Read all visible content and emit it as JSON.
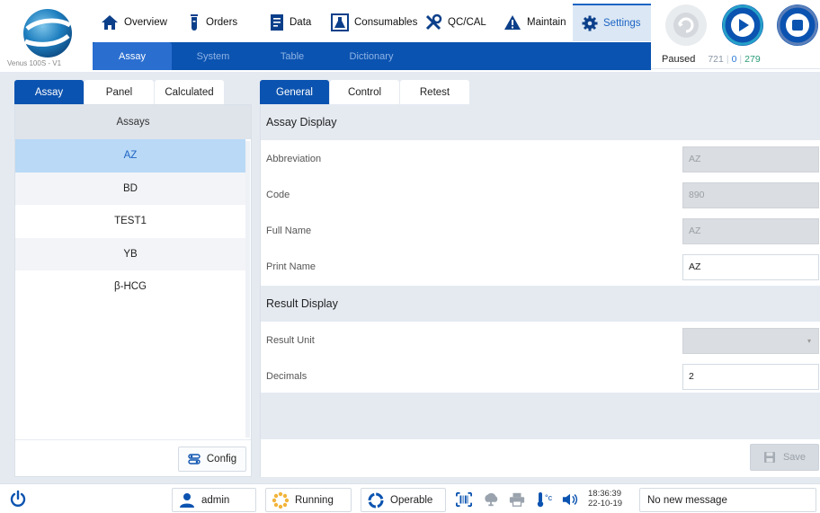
{
  "app": {
    "version": "Venus 100S - V1"
  },
  "nav": {
    "items": [
      {
        "label": "Overview",
        "icon": "home-icon"
      },
      {
        "label": "Orders",
        "icon": "test-tube-icon"
      },
      {
        "label": "Data",
        "icon": "document-icon"
      },
      {
        "label": "Consumables",
        "icon": "flask-icon"
      },
      {
        "label": "QC/CAL",
        "icon": "tools-icon"
      },
      {
        "label": "Maintain",
        "icon": "warning-icon"
      },
      {
        "label": "Settings",
        "icon": "gear-icon"
      }
    ],
    "active": "Settings"
  },
  "subnav": {
    "tabs": [
      "Assay",
      "System",
      "Table",
      "Dictionary"
    ],
    "active": "Assay"
  },
  "run_status": {
    "state": "Paused",
    "count_a": "721",
    "count_b": "0",
    "count_c": "279",
    "sep": "|"
  },
  "left": {
    "tabs": [
      "Assay",
      "Panel",
      "Calculated"
    ],
    "active_tab": "Assay",
    "list_header": "Assays",
    "assays": [
      "AZ",
      "BD",
      "TEST1",
      "YB",
      "β-HCG"
    ],
    "selected": "AZ",
    "config_label": "Config"
  },
  "right": {
    "tabs": [
      "General",
      "Control",
      "Retest"
    ],
    "active_tab": "General",
    "sections": {
      "assay_display": "Assay Display",
      "result_display": "Result Display"
    },
    "fields": {
      "abbreviation": {
        "label": "Abbreviation",
        "value": "AZ"
      },
      "code": {
        "label": "Code",
        "value": "890"
      },
      "full_name": {
        "label": "Full Name",
        "value": "AZ"
      },
      "print_name": {
        "label": "Print Name",
        "value": "AZ"
      },
      "result_unit": {
        "label": "Result Unit",
        "value": ""
      },
      "decimals": {
        "label": "Decimals",
        "value": "2"
      }
    },
    "save_label": "Save"
  },
  "footer": {
    "user": "admin",
    "running": "Running",
    "operable": "Operable",
    "time": "18:36:39",
    "date": "22-10-19",
    "message": "No new message"
  },
  "colors": {
    "primary": "#0b53b0",
    "accent": "#1d64c4",
    "selection": "#b9d9f6",
    "panel_bg": "#e5eaf1"
  }
}
